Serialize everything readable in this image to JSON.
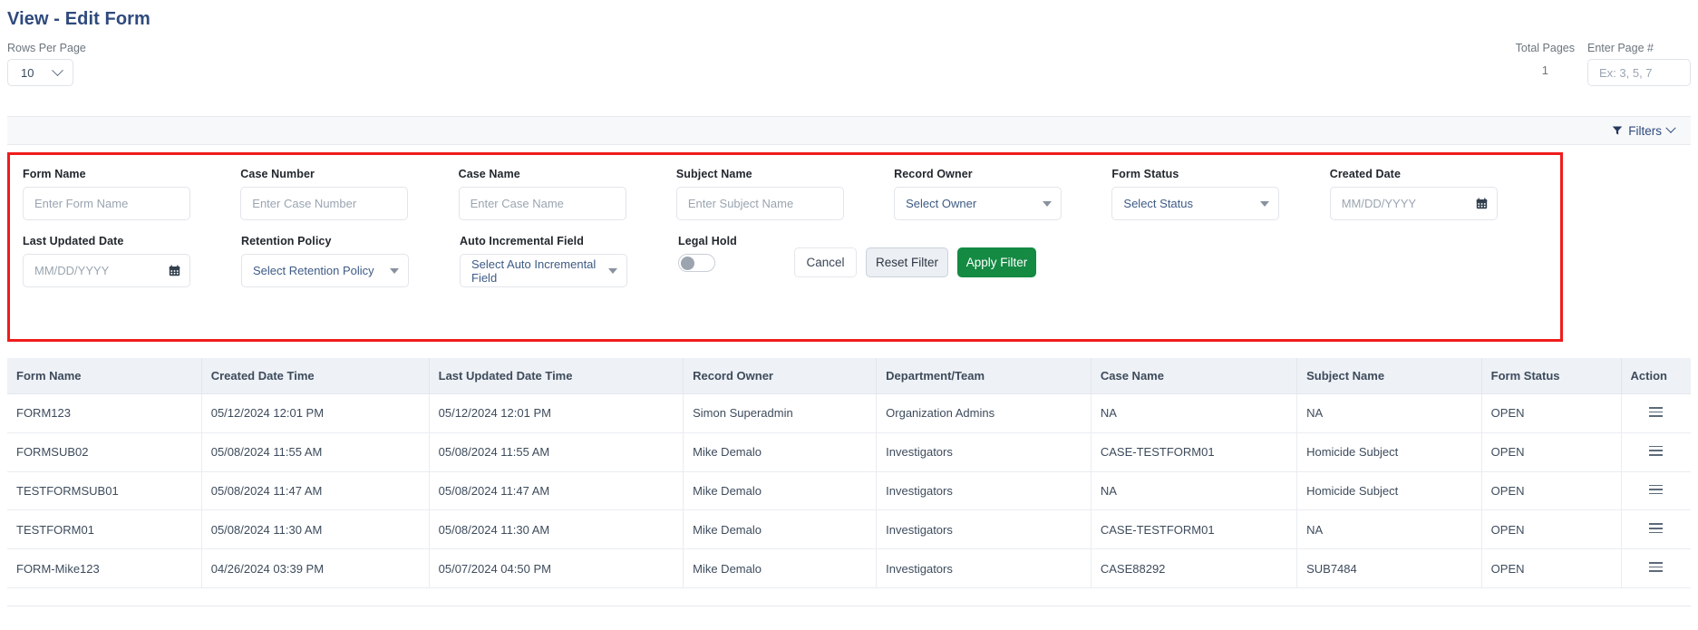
{
  "header": {
    "title": "View - Edit Form",
    "rows_per_page_label": "Rows Per Page",
    "rows_per_page_value": "10",
    "total_pages_label": "Total Pages",
    "total_pages_value": "1",
    "enter_page_label": "Enter Page #",
    "enter_page_placeholder": "Ex: 3, 5, 7",
    "enter_page_value": ""
  },
  "filters_bar": {
    "label": "Filters",
    "icon": "funnel-icon",
    "chevron": "chevron-down-icon"
  },
  "filter_panel": {
    "highlight_color": "#f01c1c",
    "row1": [
      {
        "label": "Form Name",
        "type": "text",
        "placeholder": "Enter Form Name",
        "value": ""
      },
      {
        "label": "Case Number",
        "type": "text",
        "placeholder": "Enter Case Number",
        "value": ""
      },
      {
        "label": "Case Name",
        "type": "text",
        "placeholder": "Enter Case Name",
        "value": ""
      },
      {
        "label": "Subject Name",
        "type": "text",
        "placeholder": "Enter Subject Name",
        "value": ""
      },
      {
        "label": "Record Owner",
        "type": "select",
        "placeholder": "Select Owner",
        "value": "Select Owner"
      },
      {
        "label": "Form Status",
        "type": "select",
        "placeholder": "Select Status",
        "value": "Select Status"
      },
      {
        "label": "Created Date",
        "type": "date",
        "placeholder": "MM/DD/YYYY",
        "value": ""
      }
    ],
    "row2": [
      {
        "label": "Last Updated Date",
        "type": "date",
        "placeholder": "MM/DD/YYYY",
        "value": ""
      },
      {
        "label": "Retention Policy",
        "type": "select",
        "placeholder": "Select Retention Policy",
        "value": "Select Retention Policy"
      },
      {
        "label": "Auto Incremental Field",
        "type": "select",
        "placeholder": "Select Auto Incremental Field",
        "value": "Select Auto Incremental Field"
      }
    ],
    "legal_hold": {
      "label": "Legal Hold",
      "on": false
    },
    "buttons": {
      "cancel": "Cancel",
      "reset": "Reset Filter",
      "apply": "Apply Filter",
      "apply_color": "#148a43"
    }
  },
  "table": {
    "columns": [
      "Form Name",
      "Created Date Time",
      "Last Updated Date Time",
      "Record Owner",
      "Department/Team",
      "Case Name",
      "Subject Name",
      "Form Status",
      "Action"
    ],
    "rows": [
      {
        "form_name": "FORM123",
        "created": "05/12/2024 12:01 PM",
        "updated": "05/12/2024 12:01 PM",
        "owner": "Simon Superadmin",
        "department": "Organization Admins",
        "case_name": "NA",
        "subject_name": "NA",
        "status": "OPEN",
        "action": "menu-icon"
      },
      {
        "form_name": "FORMSUB02",
        "created": "05/08/2024 11:55 AM",
        "updated": "05/08/2024 11:55 AM",
        "owner": "Mike Demalo",
        "department": "Investigators",
        "case_name": "CASE-TESTFORM01",
        "subject_name": "Homicide Subject",
        "status": "OPEN",
        "action": "menu-icon"
      },
      {
        "form_name": "TESTFORMSUB01",
        "created": "05/08/2024 11:47 AM",
        "updated": "05/08/2024 11:47 AM",
        "owner": "Mike Demalo",
        "department": "Investigators",
        "case_name": "NA",
        "subject_name": "Homicide Subject",
        "status": "OPEN",
        "action": "menu-icon"
      },
      {
        "form_name": "TESTFORM01",
        "created": "05/08/2024 11:30 AM",
        "updated": "05/08/2024 11:30 AM",
        "owner": "Mike Demalo",
        "department": "Investigators",
        "case_name": "CASE-TESTFORM01",
        "subject_name": "NA",
        "status": "OPEN",
        "action": "menu-icon"
      },
      {
        "form_name": "FORM-Mike123",
        "created": "04/26/2024 03:39 PM",
        "updated": "05/07/2024 04:50 PM",
        "owner": "Mike Demalo",
        "department": "Investigators",
        "case_name": "CASE88292",
        "subject_name": "SUB7484",
        "status": "OPEN",
        "action": "menu-icon"
      }
    ]
  }
}
